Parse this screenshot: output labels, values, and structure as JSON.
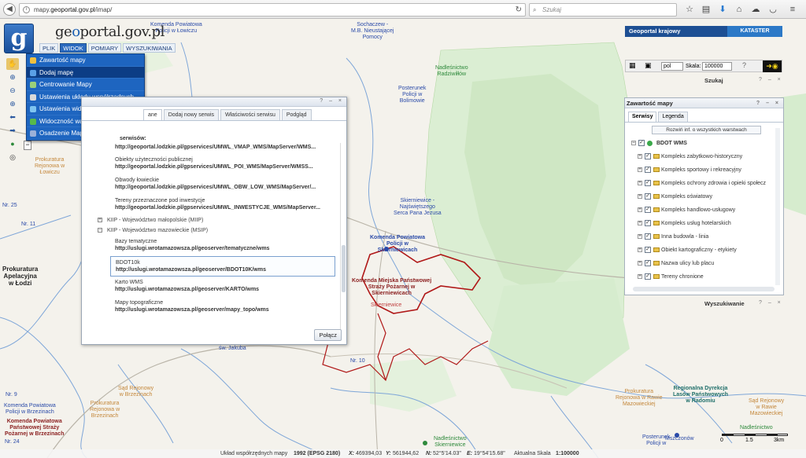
{
  "browser": {
    "url_prefix": "mapy.",
    "url_domain": "geoportal.gov.pl",
    "url_path": "/imap/",
    "search_placeholder": "Szukaj"
  },
  "header": {
    "logo_letter": "g",
    "title_pre": "ge",
    "title_hl": "o",
    "title_post": "portal.gov.pl",
    "menu": [
      "PLIK",
      "WIDOK",
      "POMIARY",
      "WYSZUKIWANIA"
    ]
  },
  "dropdown": {
    "items": [
      "Zawartość mapy",
      "Dodaj mapę",
      "Centrowanie Mapy",
      "Ustawienia układu współrzędnych",
      "Ustawienia widoczności",
      "Widoczność warstw i serwisów",
      "Osadzenie Mapy"
    ],
    "icon_colors": [
      "#f0c040",
      "#5aa0e6",
      "#9ad07a",
      "#d9d9d9",
      "#7fc4f0",
      "#57b94c",
      "#9ab0d8"
    ]
  },
  "service_dialog": {
    "tabs": [
      "ane",
      "Dodaj nowy serwis",
      "Właściwości serwisu",
      "Podgląd"
    ],
    "heading": "serwisów:",
    "entries_top": [
      {
        "name": "",
        "url": "http://geoportal.lodzkie.pl/gpservices/UMWL_VMAP_WMS/MapServer/WMS..."
      },
      {
        "name": "Obiekty użyteczności publicznej",
        "url": "http://geoportal.lodzkie.pl/gpservices/UMWL_POI_WMS/MapServer/WMSS..."
      },
      {
        "name": "Obwody łowieckie",
        "url": "http://geoportal.lodzkie.pl/gpservices/UMWL_OBW_LOW_WMS/MapServer/..."
      },
      {
        "name": "Tereny przeznaczone pod inwestycje",
        "url": "http://geoportal.lodzkie.pl/gpservices/UMWL_INWESTYCJE_WMS/MapServer..."
      }
    ],
    "groups": [
      "KIIP - Województwo małopolskie (MIIP)",
      "KIIP - Województwo mazowieckie (MSIP)"
    ],
    "entries_bottom": [
      {
        "name": "Bazy tematyczne",
        "url": "http://uslugi.wrotamazowsza.pl/geoserver/tematyczne/wms"
      },
      {
        "name": "BDOT10k",
        "url": "http://uslugi.wrotamazowsza.pl/geoserver/BDOT10K/wms"
      },
      {
        "name": "Karto WMS",
        "url": "http://uslugi.wrotamazowsza.pl/geoserver/KARTO/wms"
      },
      {
        "name": "Mapy topograficzne",
        "url": "http://uslugi.wrotamazowsza.pl/geoserver/mapy_topo/wms"
      }
    ],
    "connect_label": "Połącz"
  },
  "right_panel": {
    "title": "Geoportal krajowy",
    "kataster": "KATASTER",
    "lang": "pol",
    "scale_label": "Skala:",
    "scale_value": "100000",
    "szukaj": "Szukaj",
    "layers_title": "Zawartość mapy",
    "tabs": [
      "Serwisy",
      "Legenda"
    ],
    "expand_label": "Rozwiń inf. o wszystkich warstwach",
    "root_layer": "BDOT WMS",
    "layers": [
      "Kompleks zabytkowo-historyczny",
      "Kompleks sportowy i rekreacyjny",
      "Kompleks ochrony zdrowia i opieki społecz",
      "Kompleks oświatowy",
      "Kompleks handlowo-usługowy",
      "Kompleks usług hotelarskich",
      "Inna budowla - linia",
      "Obiekt kartograficzny - etykiety",
      "Nazwa ulicy lub placu",
      "Tereny chronione"
    ],
    "wyszukiwanie": "Wyszukiwanie"
  },
  "map_labels": {
    "komenda_powiatowa_top": "Komenda Powiatowa\nPolicji w Łowiczu",
    "sochaczew": "Sochaczew -\nM.B. Nieustającej\nPomocy",
    "nadlesnictwo_radziwillow": "Nadleśnictwo\nRadziwiłłów",
    "posterunek_bolimow": "Posterunek\nPolicji w\nBolimowie",
    "prokuratura_lowicz": "Prokuratura\nRejonowa w\nŁowiczu",
    "nr25": "Nr. 25",
    "nr11": "Nr. 11",
    "prokuratura_apelacyjna": "Prokuratura\nApelacyjna\nw Łodzi",
    "skierniewice_serca": "Skierniewice -\nNajświętszego\nSerca Pana Jezusa",
    "komenda_powiatowa_skierniewice": "Komenda Powiatowa\nPolicji w\nSkierniewicach",
    "komenda_miejska_psp": "Komenda Miejska Państwowej\nStraży Pożarnej w\nSkierniewicach",
    "skierniewice": "Skierniewice",
    "nr10": "Nr. 10",
    "sw_jakuba": "św. Jakuba",
    "sad_brzeziny": "Sąd Rejonowy\nw Brzezinach",
    "prokuratura_brzeziny": "Prokuratura\nRejonowa w\nBrzezinach",
    "nr9": "Nr. 9",
    "kpp_brzeziny": "Komenda Powiatowa\nPolicji w Brzezinach",
    "kpsp_brzeziny": "Komenda Powiatowa\nPaństwowej Straży\nPożarnej w Brzezinach",
    "nr24": "Nr. 24",
    "nadlesnictwo_skierniewice": "Nadleśnictwo\nSkierniewice",
    "prokuratura_rawa": "Prokuratura\nRejonowa w Rawie\nMazowieckiej",
    "rdlp_radom": "Regionalna Dyrekcja\nLasów Państwowych\nw Radomiu",
    "sad_rawa": "Sąd Rejonowy\nw Rawie\nMazowieckiej",
    "nadlesnictwo_bottom": "Nadleśnictwo",
    "mszczonow": "Mszczonów",
    "posterunek_bottom": "Posterunek\nPolicji w"
  },
  "status_bar": {
    "system_label": "Układ współrzędnych mapy",
    "system_value": "1992 (EPSG 2180)",
    "x_label": "X:",
    "x_value": "469394,03",
    "y_label": "Y:",
    "y_value": "561944,62",
    "n_label": "N:",
    "n_value": "52°5'14.03\"",
    "e_label": "E:",
    "e_value": "19°54'15.68\"",
    "scale_label": "Aktualna Skala",
    "scale_value": "1:100000"
  },
  "scalebar": {
    "t0": "0",
    "t1": "1.5",
    "t2": "3km"
  }
}
